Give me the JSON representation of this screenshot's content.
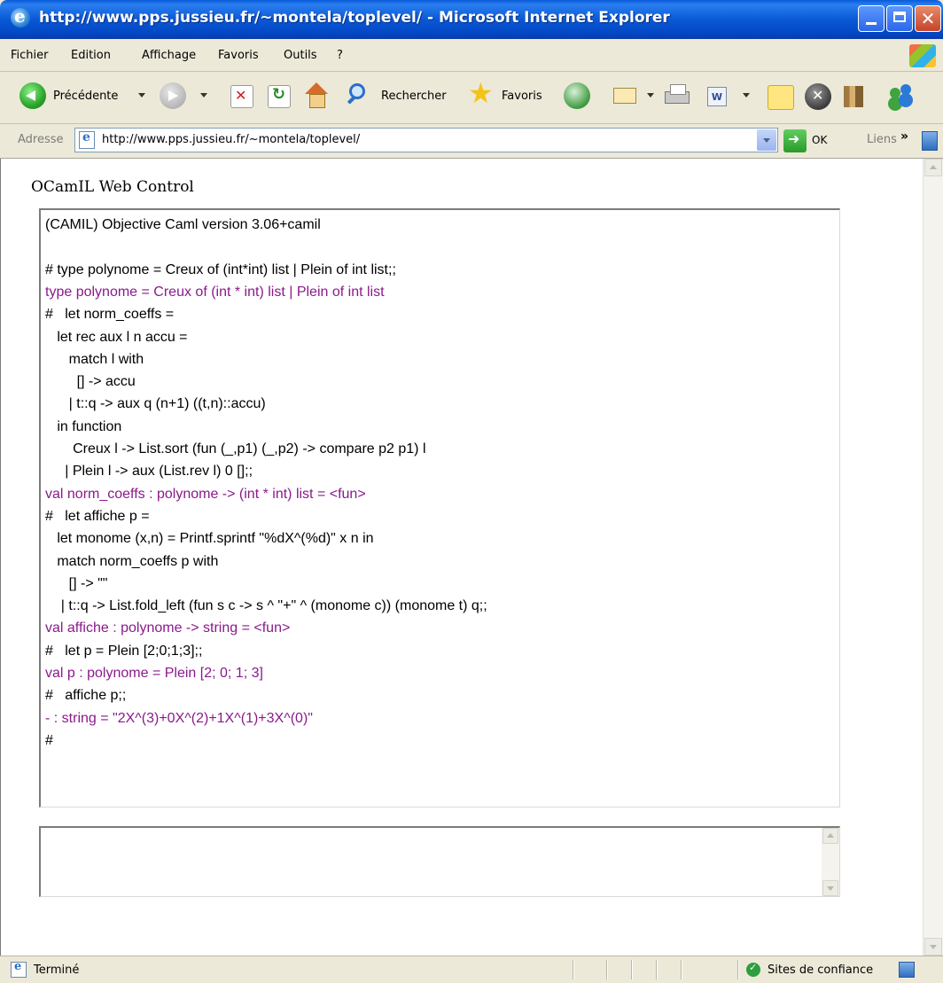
{
  "window": {
    "title": "http://www.pps.jussieu.fr/~montela/toplevel/ - Microsoft Internet Explorer"
  },
  "menu": [
    "Fichier",
    "Edition",
    "Affichage",
    "Favoris",
    "Outils",
    "?"
  ],
  "toolbar": {
    "back_label": "Précédente",
    "search_label": "Rechercher",
    "favorites_label": "Favoris"
  },
  "address": {
    "label": "Adresse",
    "url": "http://www.pps.jussieu.fr/~montela/toplevel/",
    "go_label": "OK",
    "links_label": "Liens",
    "chevron": "»"
  },
  "page": {
    "heading": "OCamIL Web Control",
    "output_lines": [
      {
        "text": "(CAMIL) Objective Caml version 3.06+camil",
        "type": "out"
      },
      {
        "text": "",
        "type": "out"
      },
      {
        "text": "# type polynome = Creux of (int*int) list | Plein of int list;;",
        "type": "in"
      },
      {
        "text": "type polynome = Creux of (int * int) list | Plein of int list",
        "type": "resp"
      },
      {
        "text": "#   let norm_coeffs =",
        "type": "in"
      },
      {
        "text": "   let rec aux l n accu =",
        "type": "in"
      },
      {
        "text": "      match l with",
        "type": "in"
      },
      {
        "text": "        [] -> accu",
        "type": "in"
      },
      {
        "text": "      | t::q -> aux q (n+1) ((t,n)::accu)",
        "type": "in"
      },
      {
        "text": "   in function",
        "type": "in"
      },
      {
        "text": "       Creux l -> List.sort (fun (_,p1) (_,p2) -> compare p2 p1) l",
        "type": "in"
      },
      {
        "text": "     | Plein l -> aux (List.rev l) 0 [];;",
        "type": "in"
      },
      {
        "text": "val norm_coeffs : polynome -> (int * int) list = <fun>",
        "type": "resp"
      },
      {
        "text": "#   let affiche p =",
        "type": "in"
      },
      {
        "text": "   let monome (x,n) = Printf.sprintf \"%dX^(%d)\" x n in",
        "type": "in"
      },
      {
        "text": "   match norm_coeffs p with",
        "type": "in"
      },
      {
        "text": "      [] -> \"\"",
        "type": "in"
      },
      {
        "text": "    | t::q -> List.fold_left (fun s c -> s ^ \"+\" ^ (monome c)) (monome t) q;;",
        "type": "in"
      },
      {
        "text": "val affiche : polynome -> string = <fun>",
        "type": "resp"
      },
      {
        "text": "#   let p = Plein [2;0;1;3];;",
        "type": "in"
      },
      {
        "text": "val p : polynome = Plein [2; 0; 1; 3]",
        "type": "resp"
      },
      {
        "text": "#   affiche p;;",
        "type": "in"
      },
      {
        "text": "- : string = \"2X^(3)+0X^(2)+1X^(1)+3X^(0)\"",
        "type": "resp"
      },
      {
        "text": "#",
        "type": "in"
      }
    ],
    "input_value": ""
  },
  "status": {
    "text": "Terminé",
    "zone": "Sites de confiance"
  },
  "colors": {
    "response_text": "#8a1a8a"
  }
}
